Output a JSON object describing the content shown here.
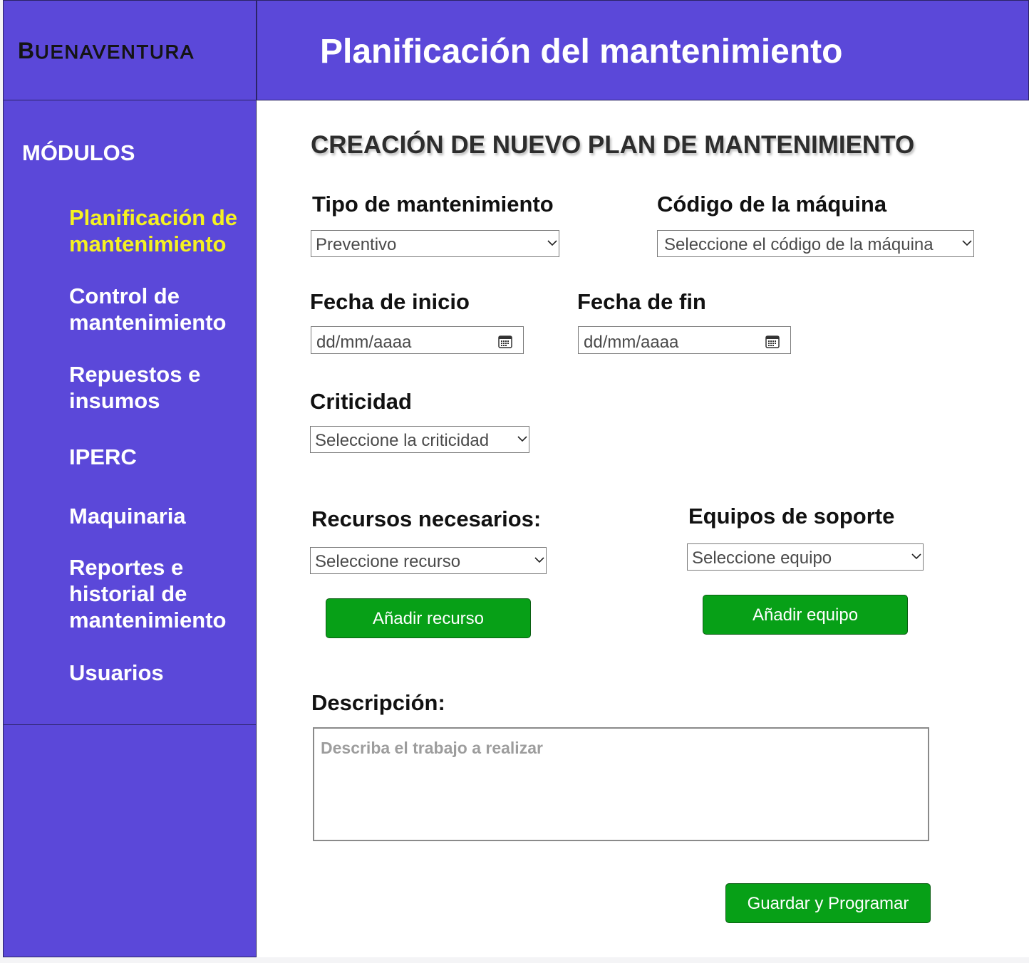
{
  "brand": {
    "logo_first": "B",
    "logo_rest": "UENAVENTURA"
  },
  "header": {
    "title": "Planificación del mantenimiento"
  },
  "sidebar": {
    "title": "MÓDULOS",
    "items": [
      {
        "label": "Planificación de mantenimiento",
        "active": true
      },
      {
        "label": "Control de mantenimiento"
      },
      {
        "label": "Repuestos e insumos"
      },
      {
        "label": "IPERC"
      },
      {
        "label": "Maquinaria"
      },
      {
        "label": "Reportes e historial de mantenimiento"
      },
      {
        "label": "Usuarios"
      }
    ]
  },
  "form": {
    "title": "CREACIÓN DE NUEVO PLAN DE MANTENIMIENTO",
    "maintenance_type": {
      "label": "Tipo de mantenimiento",
      "value": "Preventivo"
    },
    "machine_code": {
      "label": "Código de la máquina",
      "value": "Seleccione el código de la máquina"
    },
    "start_date": {
      "label": "Fecha de inicio",
      "placeholder": "dd/mm/aaaa"
    },
    "end_date": {
      "label": "Fecha de fin",
      "placeholder": "dd/mm/aaaa"
    },
    "criticality": {
      "label": "Criticidad",
      "value": "Seleccione la criticidad"
    },
    "resources": {
      "label": "Recursos necesarios:",
      "value": "Seleccione recurso",
      "button": "Añadir recurso"
    },
    "support_equipment": {
      "label": "Equipos de soporte",
      "value": "Seleccione equipo",
      "button": "Añadir equipo"
    },
    "description": {
      "label": "Descripción:",
      "placeholder": "Describa el trabajo a realizar"
    },
    "submit": "Guardar y Programar"
  },
  "colors": {
    "primary": "#5b48d9",
    "active_nav": "#f5f221",
    "button": "#07a017"
  },
  "icons": {
    "dropdown": "chevron-down-icon",
    "calendar": "calendar-icon"
  }
}
